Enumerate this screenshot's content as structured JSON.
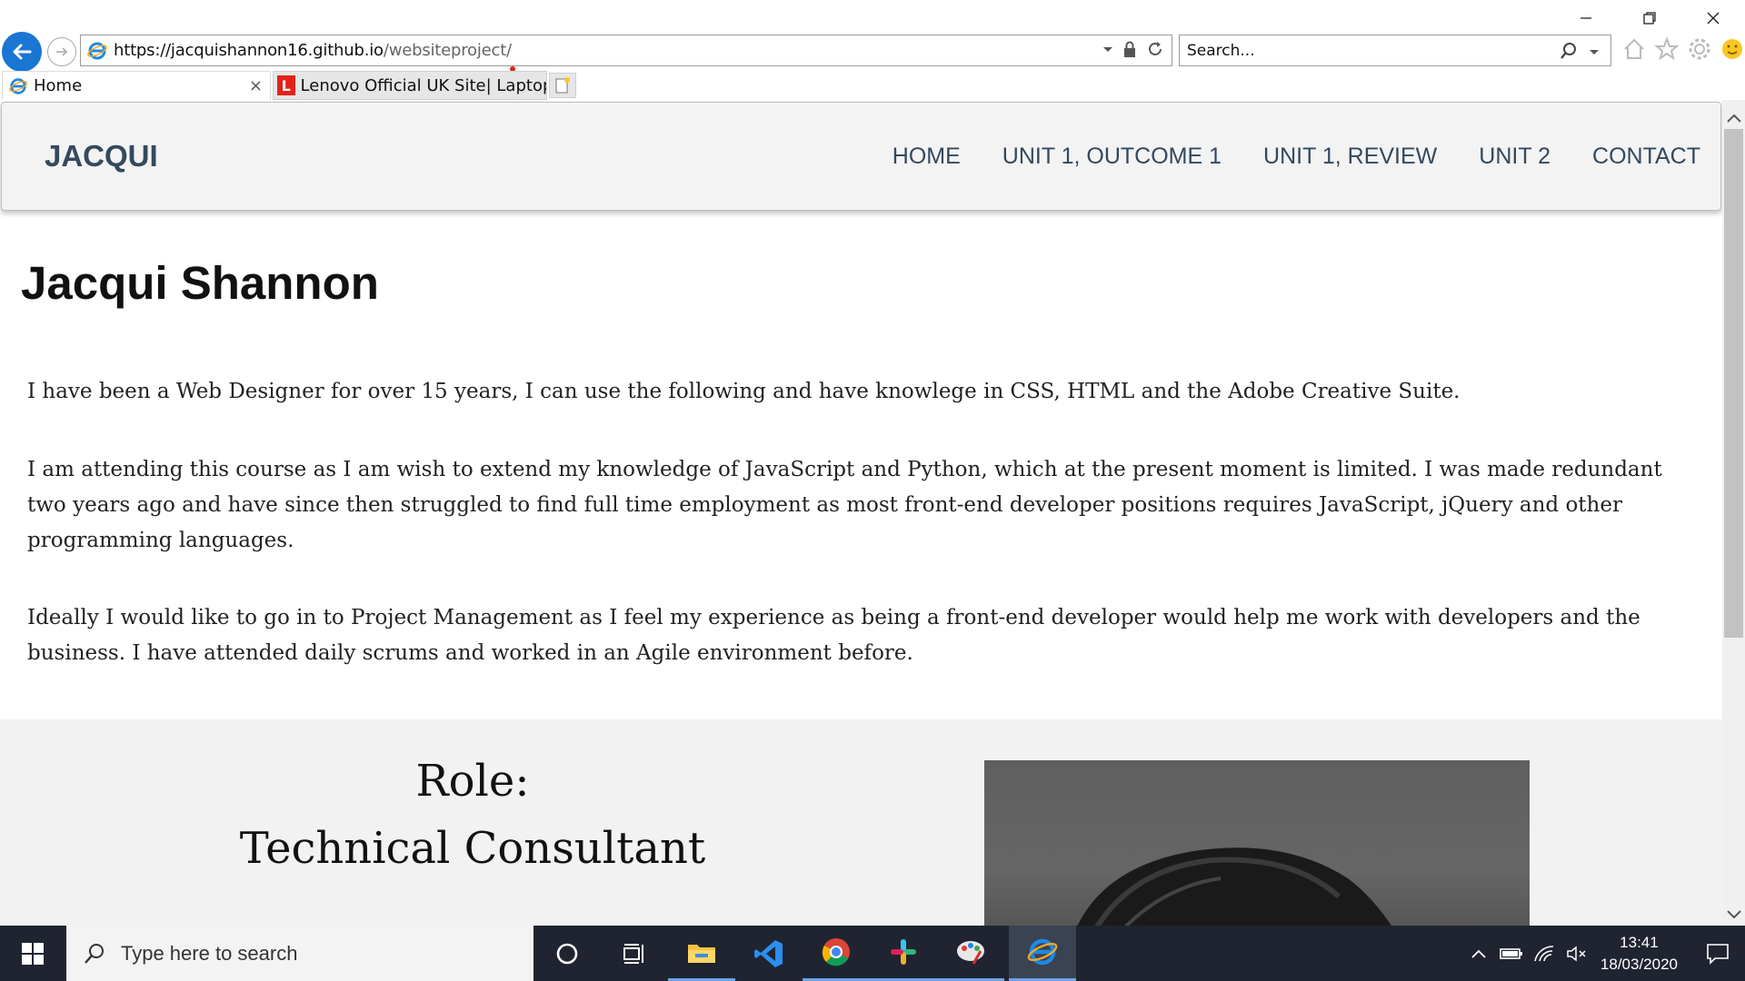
{
  "browser": {
    "url_host": "https://jacquishannon16.github.io",
    "url_path": "/websiteproject/",
    "search_placeholder": "Search...",
    "tabs": [
      {
        "label": "Home",
        "close": "×"
      },
      {
        "label": "Lenovo Official UK Site| Laptops...",
        "badge": "L"
      }
    ]
  },
  "site": {
    "brand": "JACQUI",
    "nav": [
      "HOME",
      "UNIT 1, OUTCOME 1",
      "UNIT 1, REVIEW",
      "UNIT 2",
      "CONTACT"
    ],
    "title": "Jacqui Shannon",
    "paragraphs": [
      "I have been a Web Designer for over 15 years, I can use the following and have knowlege in CSS, HTML and the Adobe Creative Suite.",
      "I am attending this course as I am wish to extend my knowledge of JavaScript and Python, which at the present moment is limited. I was made redundant two years ago and have since then struggled to find full time employment as most front-end developer positions requires JavaScript, jQuery and other programming languages.",
      "Ideally I would like to go in to Project Management as I feel my experience as being a front-end developer would help me work with developers and the business. I have attended daily scrums and worked in an Agile environment before."
    ],
    "role_label": "Role:",
    "role_value": "Technical Consultant"
  },
  "taskbar": {
    "search_placeholder": "Type here to search",
    "time": "13:41",
    "date": "18/03/2020",
    "apps": [
      "cortana-icon",
      "task-view-icon",
      "file-explorer-icon",
      "vscode-icon",
      "chrome-icon",
      "slack-icon",
      "paint-icon",
      "internet-explorer-icon"
    ]
  },
  "colors": {
    "brand_text": "#34495e",
    "header_bg": "#f3f3f3",
    "taskbar_bg": "#1f2430",
    "ie_blue": "#1976d2"
  }
}
